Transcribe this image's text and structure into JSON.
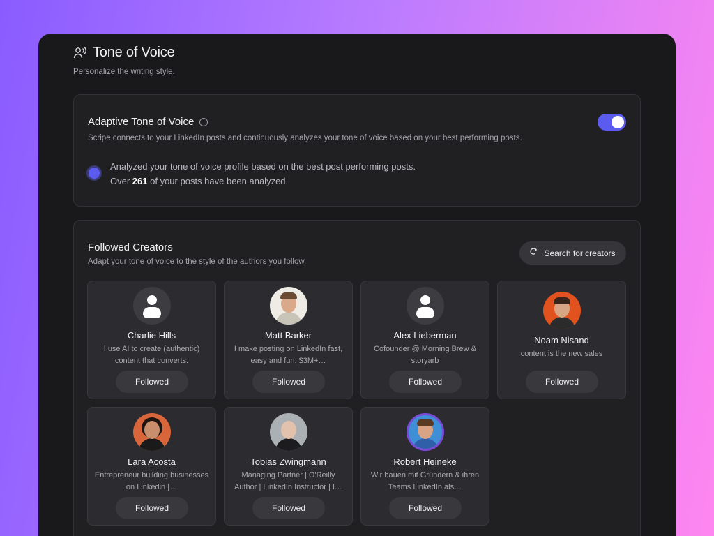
{
  "page": {
    "title": "Tone of Voice",
    "subtitle": "Personalize the writing style.",
    "title_icon": "user-voice-icon"
  },
  "adaptive": {
    "title": "Adaptive Tone of Voice",
    "info_icon": "info-icon",
    "description": "Scripe connects to your LinkedIn posts and continuously analyzes your tone of voice based on your best performing posts.",
    "toggle_on": true,
    "analysis_line1": "Analyzed your tone of voice profile based on the best post performing posts.",
    "analysis_line2_prefix": "Over",
    "analysis_count": "261",
    "analysis_line2_suffix": "of your posts have been analyzed."
  },
  "creators": {
    "title": "Followed Creators",
    "description": "Adapt your tone of voice to the style of the authors you follow.",
    "search_label": "Search for creators",
    "search_icon": "search-icon",
    "items": [
      {
        "name": "Charlie Hills",
        "bio": "I use AI to create (authentic) content that converts.",
        "button": "Followed"
      },
      {
        "name": "Matt Barker",
        "bio": "I make posting on LinkedIn fast, easy and fun. $3M+…",
        "button": "Followed"
      },
      {
        "name": "Alex Lieberman",
        "bio": "Cofounder @ Morning Brew & storyarb",
        "button": "Followed"
      },
      {
        "name": "Noam Nisand",
        "bio": "content is the new sales",
        "button": "Followed"
      },
      {
        "name": "Lara Acosta",
        "bio": "Entrepreneur building businesses on Linkedin |…",
        "button": "Followed"
      },
      {
        "name": "Tobias Zwingmann",
        "bio": "Managing Partner | O'Reilly Author | LinkedIn Instructor | I…",
        "button": "Followed"
      },
      {
        "name": "Robert Heineke",
        "bio": "Wir bauen mit Gründern & ihren Teams LinkedIn als…",
        "button": "Followed"
      }
    ]
  },
  "colors": {
    "accent": "#5b5bf0",
    "background": "#19191b",
    "card": "#202023"
  }
}
